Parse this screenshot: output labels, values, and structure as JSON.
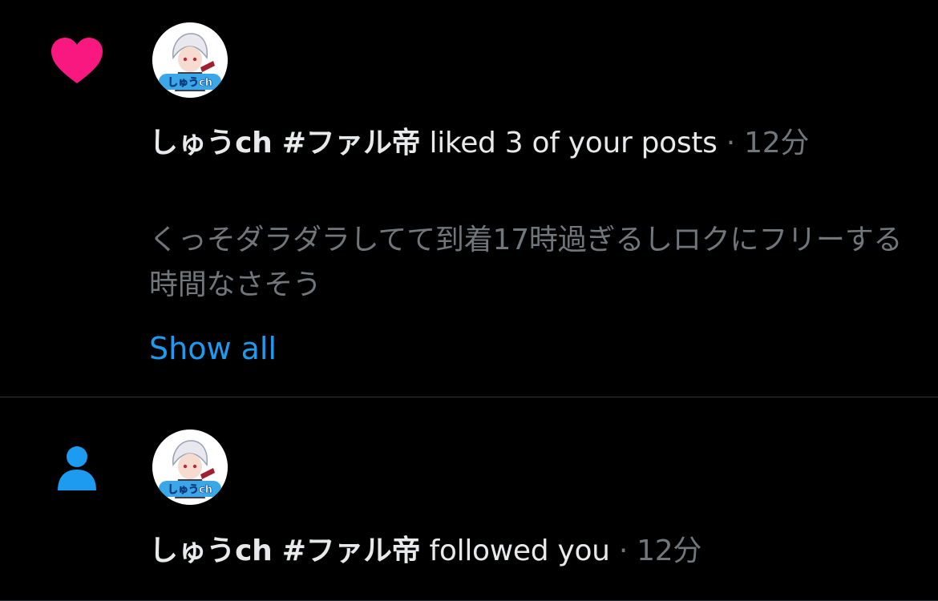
{
  "colors": {
    "background": "#000000",
    "heart": "#f91880",
    "person": "#1d9bf0",
    "link": "#1d9bf0",
    "muted": "#71767b",
    "text": "#e7e9ea"
  },
  "notifications": [
    {
      "type_icon": "heart-icon",
      "user_name": "しゅうch #ファル帝",
      "action": "liked 3 of your posts",
      "separator": "·",
      "time": "12分",
      "post_text": "くっそダラダラしてて到着17時過ぎるしロクにフリーする時間なさそう",
      "show_all_label": "Show all",
      "avatar_badge": "しゅうch"
    },
    {
      "type_icon": "person-icon",
      "user_name": "しゅうch #ファル帝",
      "action": "followed you",
      "separator": "·",
      "time": "12分",
      "avatar_badge": "しゅうch"
    }
  ]
}
